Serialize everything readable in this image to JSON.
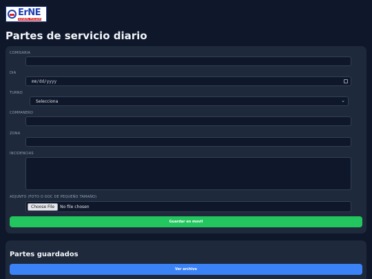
{
  "logo": {
    "main": "ErNE",
    "sub": "EUSKAL POLIZIA"
  },
  "page_title": "Partes de servicio diario",
  "form": {
    "comisaria_label": "COMISARIA",
    "dia_label": "DIA",
    "dia_placeholder": "mm/dd/yyyy",
    "turno_label": "TURNO",
    "turno_selected": "Selecciona",
    "companero_label": "COMPANERO",
    "zona_label": "ZONA",
    "incidencias_label": "INCIDENCIAS",
    "adjunto_label": "ADJUNTO (FOTO O DOC DE PEQUEÑO TAMAÑO)",
    "file_button": "Choose File",
    "file_status": "No file chosen",
    "submit_label": "Guardar en movil"
  },
  "saved": {
    "title": "Partes guardados",
    "view_label": "Ver archivo"
  },
  "colors": {
    "background": "#0f172a",
    "card": "#1e293b",
    "accent_green": "#22c55e",
    "accent_blue": "#3b82f6"
  }
}
